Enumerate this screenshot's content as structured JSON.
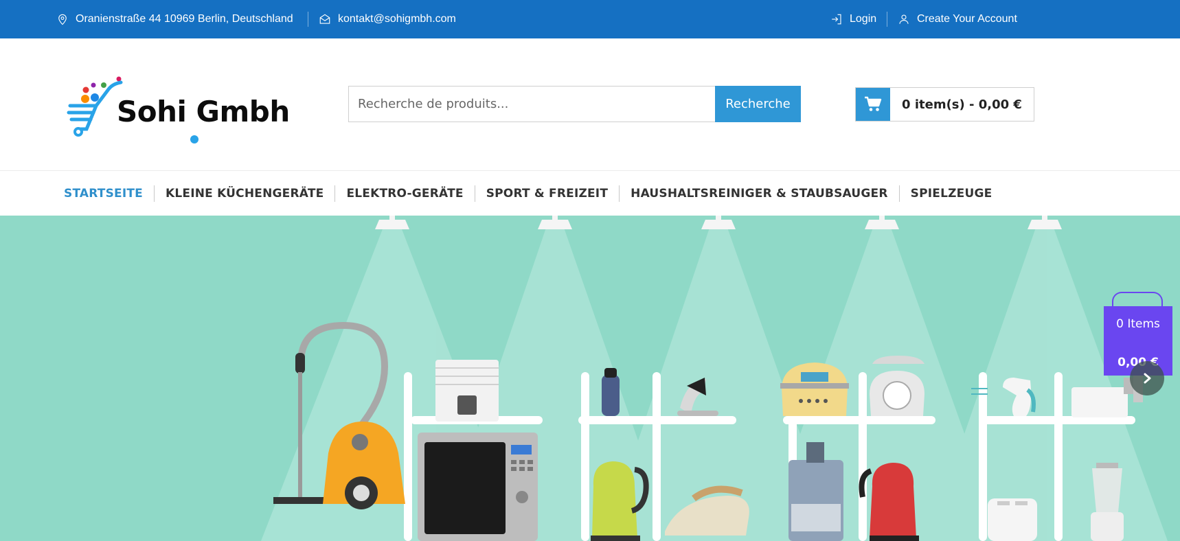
{
  "topbar": {
    "address": "Oranienstraße 44 10969 Berlin, Deutschland",
    "email": "kontakt@sohigmbh.com",
    "login": "Login",
    "create_account": "Create Your Account"
  },
  "header": {
    "logo_text": "Sohi Gmbh",
    "search_placeholder": "Recherche de produits...",
    "search_button": "Recherche",
    "cart_summary": "0 item(s) - 0,00 €"
  },
  "nav": {
    "items": [
      {
        "label": "STARTSEITE",
        "active": true
      },
      {
        "label": "KLEINE KÜCHENGERÄTE"
      },
      {
        "label": "ELEKTRO-GERÄTE"
      },
      {
        "label": "SPORT & FREIZEIT"
      },
      {
        "label": "HAUSHALTSREINIGER & STAUBSAUGER"
      },
      {
        "label": "SPIELZEUGE"
      }
    ]
  },
  "mini_cart": {
    "items": "0 Items",
    "total": "0,00 €"
  },
  "colors": {
    "topbar": "#1570c2",
    "accent": "#2f97d6",
    "hero_bg": "#8fd9c7",
    "mini_cart": "#6a46f0"
  }
}
